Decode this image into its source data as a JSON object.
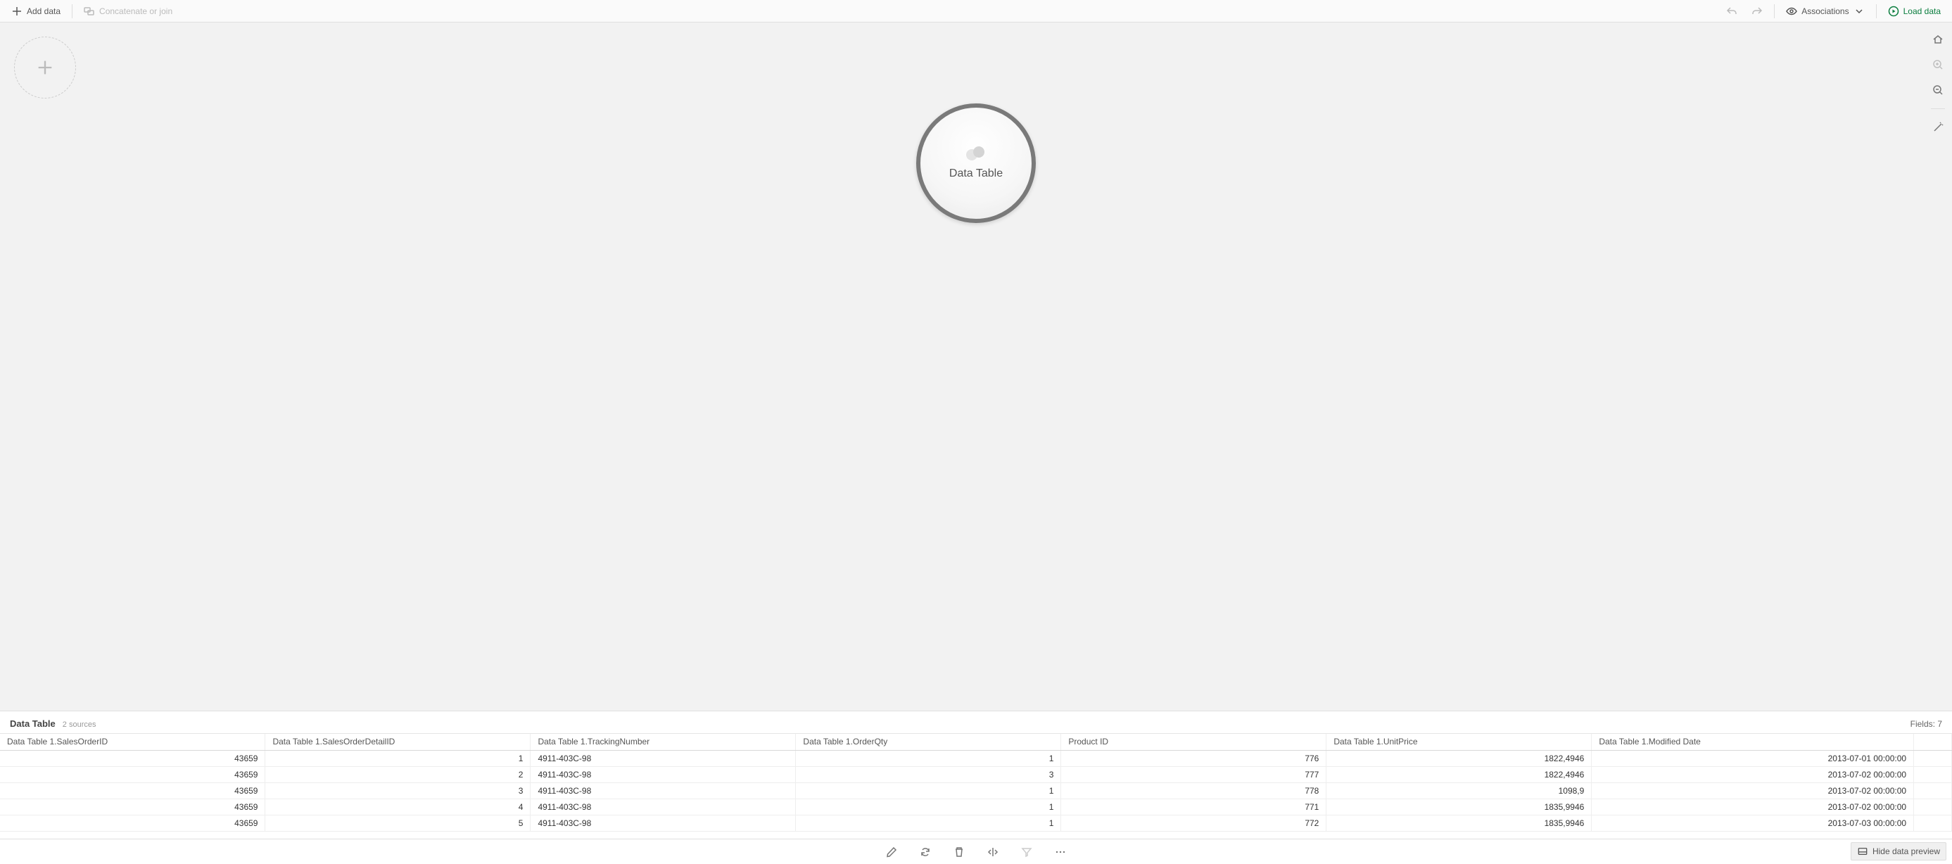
{
  "toolbar": {
    "add_data": "Add data",
    "concat_join": "Concatenate or join",
    "associations": "Associations",
    "load_data": "Load data"
  },
  "canvas": {
    "bubble_label": "Data Table"
  },
  "preview": {
    "title": "Data Table",
    "sources": "2 sources",
    "fields_label": "Fields:",
    "fields_count": "7"
  },
  "table": {
    "columns": [
      "Data Table 1.SalesOrderID",
      "Data Table 1.SalesOrderDetailID",
      "Data Table 1.TrackingNumber",
      "Data Table 1.OrderQty",
      "Product ID",
      "Data Table 1.UnitPrice",
      "Data Table 1.Modified Date"
    ],
    "col_align": [
      "num",
      "num",
      "txt",
      "num",
      "num",
      "num",
      "num"
    ],
    "rows": [
      [
        "43659",
        "1",
        "4911-403C-98",
        "1",
        "776",
        "1822,4946",
        "2013-07-01 00:00:00"
      ],
      [
        "43659",
        "2",
        "4911-403C-98",
        "3",
        "777",
        "1822,4946",
        "2013-07-02 00:00:00"
      ],
      [
        "43659",
        "3",
        "4911-403C-98",
        "1",
        "778",
        "1098,9",
        "2013-07-02 00:00:00"
      ],
      [
        "43659",
        "4",
        "4911-403C-98",
        "1",
        "771",
        "1835,9946",
        "2013-07-02 00:00:00"
      ],
      [
        "43659",
        "5",
        "4911-403C-98",
        "1",
        "772",
        "1835,9946",
        "2013-07-03 00:00:00"
      ]
    ]
  },
  "bottom": {
    "hide_preview": "Hide data preview"
  }
}
